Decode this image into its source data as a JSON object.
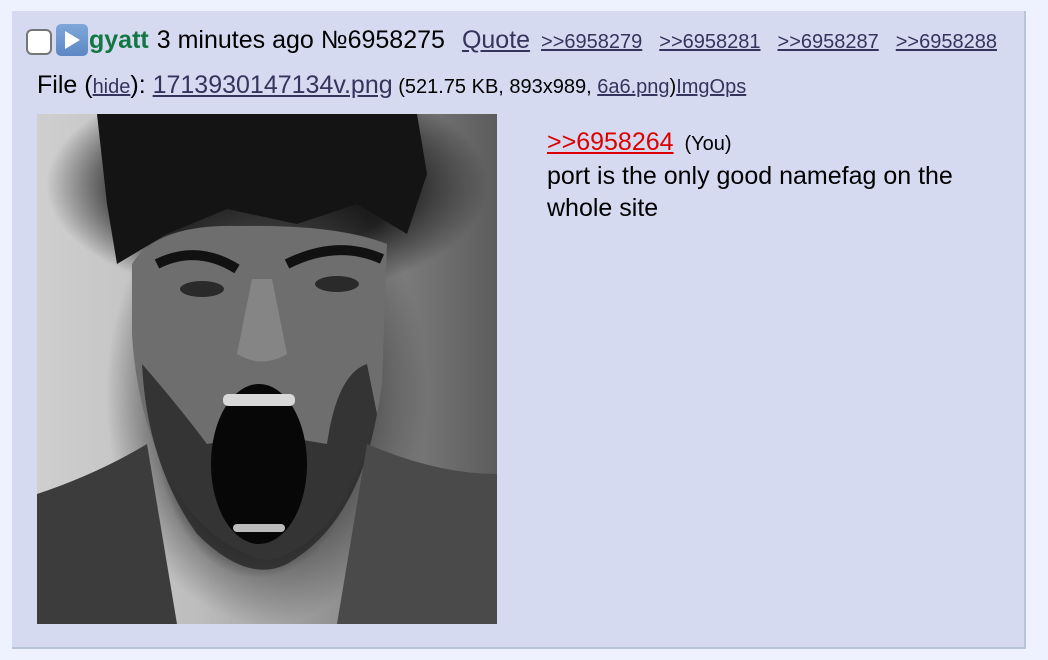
{
  "post": {
    "name": "gyatt",
    "date": "3 minutes ago",
    "number": "№6958275",
    "quote_label": "Quote",
    "backlinks": [
      ">>6958279",
      ">>6958281",
      ">>6958287",
      ">>6958288"
    ]
  },
  "file": {
    "prefix": "File (",
    "hide_label": "hide",
    "suffix": "): ",
    "filename": "1713930147134v.png",
    "info_open": " (521.75 KB, 893x989, ",
    "alt_name": "6a6.png",
    "info_close": ")",
    "imgops": "ImgOps"
  },
  "comment": {
    "quotelink": ">>6958264",
    "you": "(You)",
    "text": "port is the only good namefag on the whole site"
  },
  "icons": {
    "menu": "play-triangle-icon"
  },
  "colors": {
    "post_bg": "#d6daf0",
    "name": "#117743",
    "link": "#34345c",
    "quotelink": "#dd0000"
  }
}
